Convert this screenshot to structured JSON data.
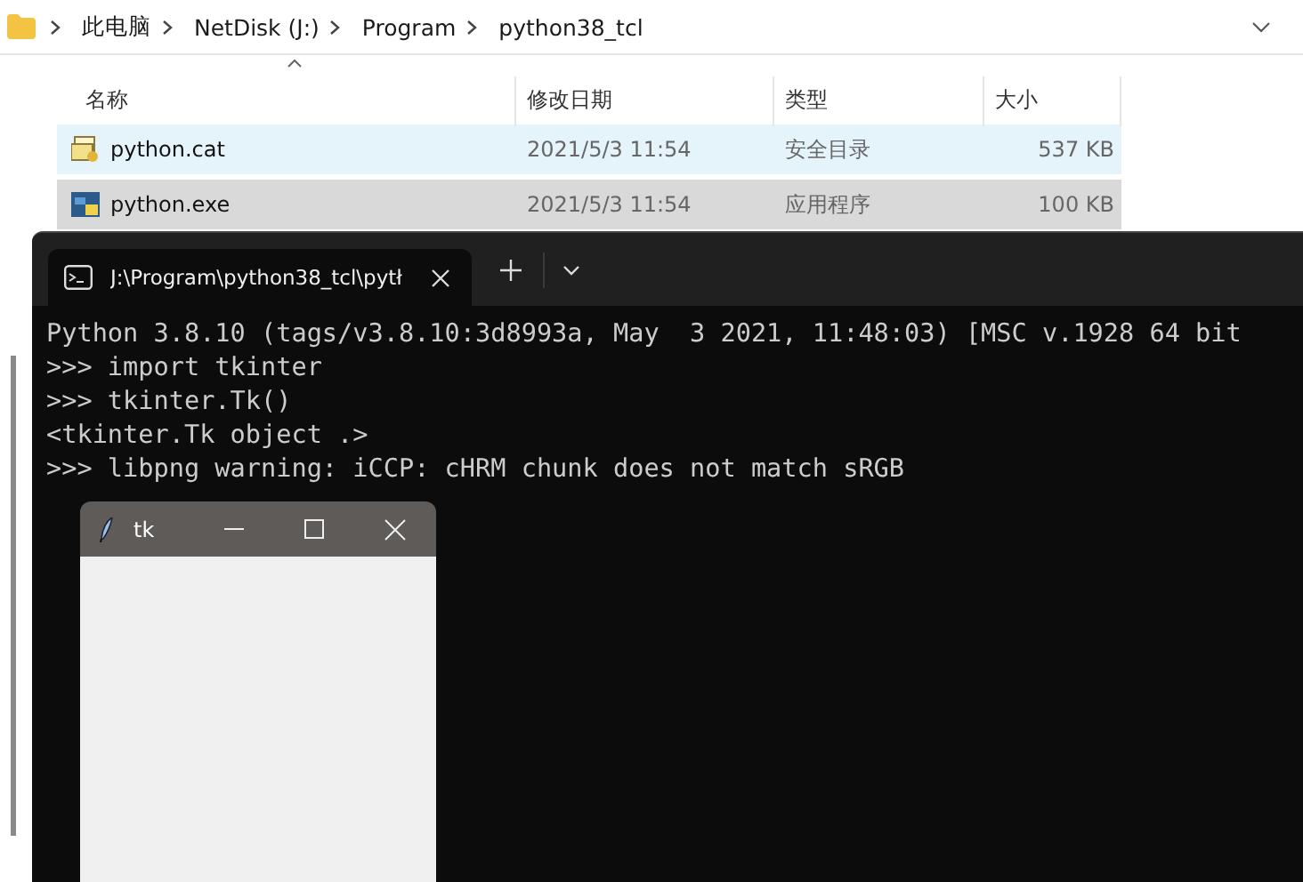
{
  "explorer": {
    "breadcrumb": [
      "此电脑",
      "NetDisk (J:)",
      "Program",
      "python38_tcl"
    ],
    "columns": [
      "名称",
      "修改日期",
      "类型",
      "大小"
    ],
    "rows": [
      {
        "name": "python.cat",
        "kind": "catalog",
        "modified": "2021/5/3 11:54",
        "type": "安全目录",
        "size": "537 KB",
        "hovered": true,
        "selected": false
      },
      {
        "name": "python.exe",
        "kind": "exe",
        "modified": "2021/5/3 11:54",
        "type": "应用程序",
        "size": "100 KB",
        "hovered": false,
        "selected": true
      }
    ]
  },
  "terminal": {
    "tab_title": "J:\\Program\\python38_tcl\\pytł",
    "lines": [
      "Python 3.8.10 (tags/v3.8.10:3d8993a, May  3 2021, 11:48:03) [MSC v.1928 64 bit",
      ">>> import tkinter",
      ">>> tkinter.Tk()",
      "<tkinter.Tk object .>",
      ">>> libpng warning: iCCP: cHRM chunk does not match sRGB"
    ]
  },
  "tk_window": {
    "title": "tk"
  }
}
